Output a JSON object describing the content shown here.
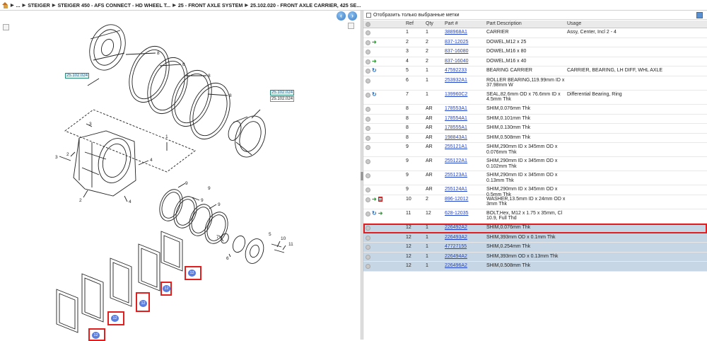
{
  "breadcrumb": {
    "items": [
      "...",
      "STEIGER",
      "STEIGER 450 - AFS CONNECT - HD WHEEL T...",
      "25 - FRONT AXLE SYSTEM",
      "25.102.020 - FRONT AXLE CARRIER, 425 SE..."
    ]
  },
  "diagram": {
    "callouts": [
      "1",
      "2",
      "3",
      "4",
      "4",
      "5",
      "6",
      "7",
      "8",
      "8",
      "8",
      "8",
      "9",
      "9",
      "9",
      "9",
      "10",
      "11"
    ],
    "ref_links": [
      "25.102.024",
      "25.102.024"
    ],
    "ref_plain": "25.102.024",
    "highlight_badge": "12"
  },
  "filter": {
    "label": "Отобразить только выбранные метки"
  },
  "table": {
    "headers": {
      "ref": "Ref",
      "qty": "Qty",
      "part": "Part #",
      "desc": "Part Description",
      "usage": "Usage"
    },
    "rows": [
      {
        "ref": "1",
        "qty": "1",
        "part": "388968A1",
        "desc": "CARRIER",
        "usage": "Assy, Center, Incl 2 - 4",
        "icons": []
      },
      {
        "ref": "2",
        "qty": "2",
        "part": "837-12025",
        "desc": "DOWEL,M12 x 25",
        "usage": "",
        "icons": [
          "green-arrow"
        ]
      },
      {
        "ref": "3",
        "qty": "2",
        "part": "837-16080",
        "desc": "DOWEL,M16 x 80",
        "usage": "",
        "icons": []
      },
      {
        "ref": "4",
        "qty": "2",
        "part": "837-16040",
        "desc": "DOWEL,M16 x 40",
        "usage": "",
        "icons": [
          "green-arrow"
        ]
      },
      {
        "ref": "5",
        "qty": "1",
        "part": "47592233",
        "desc": "BEARING CARRIER",
        "usage": "CARRIER, BEARING, LH DIFF, WHL AXLE",
        "icons": [
          "blue-arrow"
        ]
      },
      {
        "ref": "6",
        "qty": "1",
        "part": "253932A1",
        "desc": "ROLLER BEARING,119.99mm ID x 37.98mm W",
        "usage": "",
        "icons": []
      },
      {
        "ref": "7",
        "qty": "1",
        "part": "139960C2",
        "desc": "SEAL,82.6mm OD x 76.6mm ID x 4.5mm Thk",
        "usage": "Differential Bearing, Ring",
        "icons": [
          "blue-arrow"
        ]
      },
      {
        "ref": "8",
        "qty": "AR",
        "part": "178553A1",
        "desc": "SHIM,0.076mm Thk",
        "usage": "",
        "icons": []
      },
      {
        "ref": "8",
        "qty": "AR",
        "part": "178554A1",
        "desc": "SHIM,0.101mm Thk",
        "usage": "",
        "icons": []
      },
      {
        "ref": "8",
        "qty": "AR",
        "part": "178555A1",
        "desc": "SHIM,0.130mm Thk",
        "usage": "",
        "icons": []
      },
      {
        "ref": "8",
        "qty": "AR",
        "part": "198843A1",
        "desc": "SHIM,0.508mm Thk",
        "usage": "",
        "icons": []
      },
      {
        "ref": "9",
        "qty": "AR",
        "part": "255121A1",
        "desc": "SHIM,290mm ID x 345mm OD x 0.076mm Thk",
        "usage": "",
        "icons": []
      },
      {
        "ref": "9",
        "qty": "AR",
        "part": "255122A1",
        "desc": "SHIM,290mm ID x 345mm OD x 0.102mm Thk",
        "usage": "",
        "icons": []
      },
      {
        "ref": "9",
        "qty": "AR",
        "part": "255123A1",
        "desc": "SHIM,290mm ID x 345mm OD x 0.13mm Thk",
        "usage": "",
        "icons": []
      },
      {
        "ref": "9",
        "qty": "AR",
        "part": "255124A1",
        "desc": "SHIM,290mm ID x 345mm OD x 0.5mm Thk",
        "usage": "",
        "icons": []
      },
      {
        "ref": "10",
        "qty": "2",
        "part": "896-12012",
        "desc": "WASHER,13.5mm ID x 24mm OD x 3mm Thk",
        "usage": "",
        "icons": [
          "green-arrow",
          "doc"
        ]
      },
      {
        "ref": "11",
        "qty": "12",
        "part": "628-12035",
        "desc": "BOLT,Hex, M12 x 1.75 x 35mm, Cl 10.9, Full Thd",
        "usage": "",
        "icons": [
          "blue-arrow",
          "green-arrow"
        ]
      },
      {
        "ref": "12",
        "qty": "1",
        "part": "226492A2",
        "desc": "SHIM,0.076mm Thk",
        "usage": "",
        "icons": [],
        "state": "active"
      },
      {
        "ref": "12",
        "qty": "1",
        "part": "226493A2",
        "desc": "SHIM,393mm OD x 0.1mm Thk",
        "usage": "",
        "icons": [],
        "state": "selected"
      },
      {
        "ref": "12",
        "qty": "1",
        "part": "47727155",
        "desc": "SHIM,0.254mm Thk",
        "usage": "",
        "icons": [],
        "state": "selected"
      },
      {
        "ref": "12",
        "qty": "1",
        "part": "226494A2",
        "desc": "SHIM,393mm OD x 0.13mm Thk",
        "usage": "",
        "icons": [],
        "state": "selected"
      },
      {
        "ref": "12",
        "qty": "1",
        "part": "226496A2",
        "desc": "SHIM,0.508mm Thk",
        "usage": "",
        "icons": [],
        "state": "selected"
      }
    ]
  }
}
